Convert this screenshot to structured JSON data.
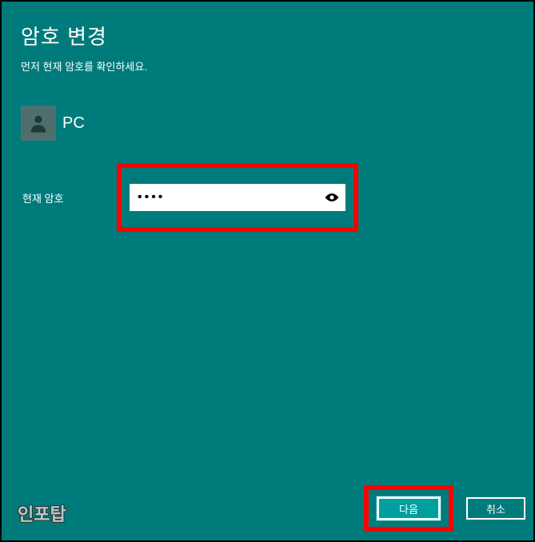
{
  "title": "암호 변경",
  "subtitle": "먼저 현재 암호를 확인하세요.",
  "user": {
    "name": "PC"
  },
  "field": {
    "label": "현재 암호",
    "value": "••••"
  },
  "buttons": {
    "next": "다음",
    "cancel": "취소"
  },
  "watermark": "인포탑"
}
